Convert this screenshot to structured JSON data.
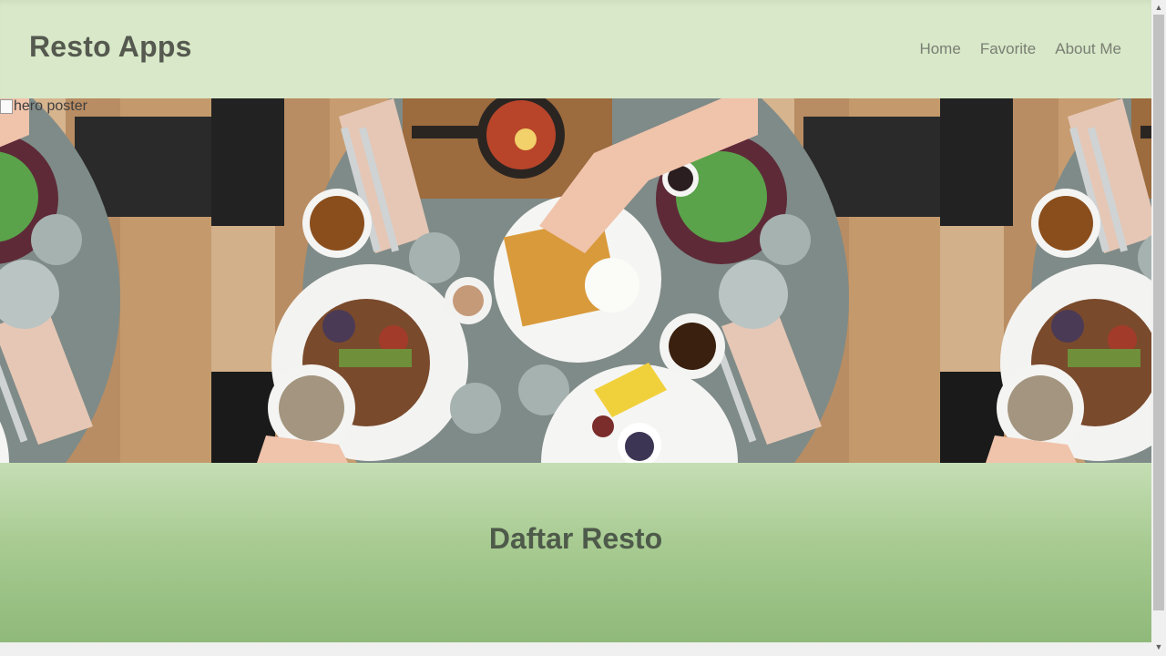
{
  "header": {
    "title": "Resto Apps",
    "nav": [
      {
        "label": "Home"
      },
      {
        "label": "Favorite"
      },
      {
        "label": "About Me"
      }
    ]
  },
  "hero": {
    "alt_text": "hero poster"
  },
  "section": {
    "title": "Daftar Resto"
  },
  "colors": {
    "header_bg": "#d8e8c8",
    "section_top": "#c5deb4",
    "section_bottom": "#8fb97a",
    "title_text": "#55594f"
  },
  "icons": {
    "scroll_up": "scroll-up-arrow-icon",
    "scroll_down": "scroll-down-arrow-icon",
    "broken_image": "broken-image-icon"
  }
}
